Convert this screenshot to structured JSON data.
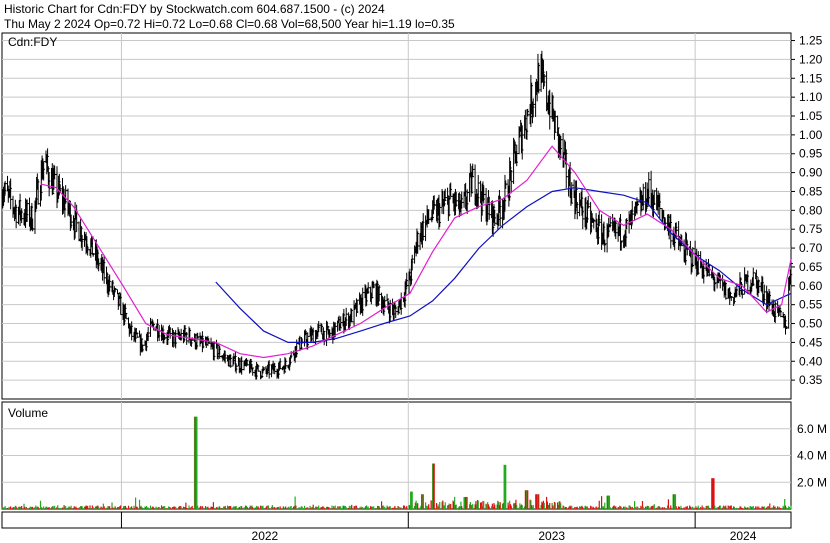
{
  "header": {
    "line1": "Historic Chart for Cdn:FDY by Stockwatch.com 604.687.1500 - (c) 2024",
    "line2": "Thu May  2 2024  Op=0.72  Hi=0.72  Lo=0.68  Cl=0.68  Vol=68,500  Year hi=1.19  lo=0.35"
  },
  "colors": {
    "price_bar": "#000000",
    "ma_short": "#e020d0",
    "ma_long": "#1010c0",
    "vol_up": "#22aa22",
    "vol_down": "#dd1111",
    "grid": "#c8c8c8"
  },
  "chart_data": [
    {
      "type": "line",
      "name": "price",
      "title": "Cdn:FDY",
      "yaxis_side": "right",
      "ylim": [
        0.3,
        1.27
      ],
      "yticks": [
        "0.35",
        "0.40",
        "0.45",
        "0.50",
        "0.55",
        "0.60",
        "0.65",
        "0.70",
        "0.75",
        "0.80",
        "0.85",
        "0.90",
        "0.95",
        "1.00",
        "1.05",
        "1.10",
        "1.15",
        "1.20",
        "1.25"
      ],
      "grid": true,
      "x_range": [
        "2021-08-02",
        "2024-05-02"
      ],
      "xticks": [
        "2022",
        "2023",
        "2024"
      ],
      "series": [
        {
          "kind": "ohlc_close",
          "points": [
            [
              "2021-08-02",
              0.86
            ],
            [
              "2021-08-20",
              0.8
            ],
            [
              "2021-09-10",
              0.78
            ],
            [
              "2021-09-24",
              0.93
            ],
            [
              "2021-10-08",
              0.86
            ],
            [
              "2021-10-22",
              0.82
            ],
            [
              "2021-11-05",
              0.76
            ],
            [
              "2021-11-19",
              0.72
            ],
            [
              "2021-12-03",
              0.66
            ],
            [
              "2021-12-17",
              0.6
            ],
            [
              "2022-01-03",
              0.53
            ],
            [
              "2022-01-14",
              0.47
            ],
            [
              "2022-01-28",
              0.44
            ],
            [
              "2022-02-11",
              0.5
            ],
            [
              "2022-02-25",
              0.47
            ],
            [
              "2022-03-11",
              0.46
            ],
            [
              "2022-03-25",
              0.47
            ],
            [
              "2022-04-08",
              0.45
            ],
            [
              "2022-04-22",
              0.44
            ],
            [
              "2022-05-06",
              0.42
            ],
            [
              "2022-05-20",
              0.4
            ],
            [
              "2022-06-03",
              0.39
            ],
            [
              "2022-06-17",
              0.38
            ],
            [
              "2022-07-01",
              0.37
            ],
            [
              "2022-07-15",
              0.38
            ],
            [
              "2022-07-29",
              0.39
            ],
            [
              "2022-08-12",
              0.44
            ],
            [
              "2022-08-26",
              0.46
            ],
            [
              "2022-09-09",
              0.48
            ],
            [
              "2022-09-23",
              0.47
            ],
            [
              "2022-10-07",
              0.5
            ],
            [
              "2022-10-21",
              0.52
            ],
            [
              "2022-11-04",
              0.56
            ],
            [
              "2022-11-18",
              0.59
            ],
            [
              "2022-12-02",
              0.55
            ],
            [
              "2022-12-16",
              0.53
            ],
            [
              "2023-01-03",
              0.62
            ],
            [
              "2023-01-13",
              0.73
            ],
            [
              "2023-01-27",
              0.78
            ],
            [
              "2023-02-10",
              0.8
            ],
            [
              "2023-02-24",
              0.83
            ],
            [
              "2023-03-10",
              0.8
            ],
            [
              "2023-03-24",
              0.88
            ],
            [
              "2023-04-07",
              0.82
            ],
            [
              "2023-04-21",
              0.78
            ],
            [
              "2023-05-05",
              0.84
            ],
            [
              "2023-05-19",
              0.96
            ],
            [
              "2023-06-02",
              1.06
            ],
            [
              "2023-06-16",
              1.16
            ],
            [
              "2023-06-30",
              1.08
            ],
            [
              "2023-07-14",
              0.96
            ],
            [
              "2023-07-28",
              0.85
            ],
            [
              "2023-08-11",
              0.8
            ],
            [
              "2023-08-25",
              0.76
            ],
            [
              "2023-09-08",
              0.73
            ],
            [
              "2023-09-22",
              0.74
            ],
            [
              "2023-10-06",
              0.75
            ],
            [
              "2023-10-20",
              0.8
            ],
            [
              "2023-11-03",
              0.85
            ],
            [
              "2023-11-17",
              0.8
            ],
            [
              "2023-12-01",
              0.75
            ],
            [
              "2023-12-15",
              0.7
            ],
            [
              "2024-01-05",
              0.66
            ],
            [
              "2024-01-19",
              0.63
            ],
            [
              "2024-02-02",
              0.6
            ],
            [
              "2024-02-16",
              0.57
            ],
            [
              "2024-03-01",
              0.6
            ],
            [
              "2024-03-15",
              0.62
            ],
            [
              "2024-03-29",
              0.58
            ],
            [
              "2024-04-12",
              0.53
            ],
            [
              "2024-04-26",
              0.5
            ],
            [
              "2024-05-02",
              0.68
            ]
          ]
        },
        {
          "kind": "moving_average_short",
          "points": [
            [
              "2021-09-20",
              0.87
            ],
            [
              "2021-10-10",
              0.86
            ],
            [
              "2021-11-01",
              0.81
            ],
            [
              "2021-12-01",
              0.71
            ],
            [
              "2022-01-03",
              0.6
            ],
            [
              "2022-02-01",
              0.5
            ],
            [
              "2022-03-01",
              0.47
            ],
            [
              "2022-04-01",
              0.46
            ],
            [
              "2022-05-01",
              0.45
            ],
            [
              "2022-06-01",
              0.42
            ],
            [
              "2022-07-01",
              0.41
            ],
            [
              "2022-08-01",
              0.42
            ],
            [
              "2022-09-01",
              0.44
            ],
            [
              "2022-10-01",
              0.47
            ],
            [
              "2022-11-01",
              0.5
            ],
            [
              "2022-12-01",
              0.54
            ],
            [
              "2023-01-03",
              0.58
            ],
            [
              "2023-02-01",
              0.69
            ],
            [
              "2023-03-01",
              0.78
            ],
            [
              "2023-04-01",
              0.81
            ],
            [
              "2023-05-01",
              0.83
            ],
            [
              "2023-06-01",
              0.88
            ],
            [
              "2023-07-03",
              0.97
            ],
            [
              "2023-08-01",
              0.9
            ],
            [
              "2023-09-01",
              0.8
            ],
            [
              "2023-10-02",
              0.76
            ],
            [
              "2023-11-01",
              0.79
            ],
            [
              "2023-12-01",
              0.75
            ],
            [
              "2024-01-02",
              0.68
            ],
            [
              "2024-02-01",
              0.62
            ],
            [
              "2024-03-01",
              0.6
            ],
            [
              "2024-04-01",
              0.53
            ],
            [
              "2024-04-20",
              0.55
            ],
            [
              "2024-05-02",
              0.67
            ]
          ]
        },
        {
          "kind": "moving_average_long",
          "points": [
            [
              "2022-05-01",
              0.61
            ],
            [
              "2022-06-01",
              0.54
            ],
            [
              "2022-07-01",
              0.48
            ],
            [
              "2022-08-01",
              0.45
            ],
            [
              "2022-09-01",
              0.45
            ],
            [
              "2022-10-01",
              0.46
            ],
            [
              "2022-11-01",
              0.48
            ],
            [
              "2022-12-01",
              0.5
            ],
            [
              "2023-01-03",
              0.52
            ],
            [
              "2023-02-01",
              0.56
            ],
            [
              "2023-03-01",
              0.62
            ],
            [
              "2023-04-01",
              0.7
            ],
            [
              "2023-05-01",
              0.76
            ],
            [
              "2023-06-01",
              0.81
            ],
            [
              "2023-07-03",
              0.85
            ],
            [
              "2023-08-01",
              0.86
            ],
            [
              "2023-09-01",
              0.85
            ],
            [
              "2023-10-02",
              0.84
            ],
            [
              "2023-11-01",
              0.82
            ],
            [
              "2023-12-01",
              0.74
            ],
            [
              "2024-01-02",
              0.68
            ],
            [
              "2024-02-01",
              0.64
            ],
            [
              "2024-03-01",
              0.59
            ],
            [
              "2024-04-01",
              0.55
            ],
            [
              "2024-05-02",
              0.58
            ]
          ]
        }
      ]
    },
    {
      "type": "bar",
      "title": "Volume",
      "yaxis_side": "right",
      "ylim": [
        0,
        8
      ],
      "yticks": [
        "2.0 M",
        "4.0 M",
        "6.0 M"
      ],
      "grid": true,
      "spikes": [
        [
          "2022-04-05",
          6.9
        ],
        [
          "2023-01-06",
          1.3
        ],
        [
          "2023-01-20",
          1.1
        ],
        [
          "2023-02-03",
          3.4
        ],
        [
          "2023-03-15",
          0.9
        ],
        [
          "2023-05-05",
          3.3
        ],
        [
          "2023-06-01",
          1.4
        ],
        [
          "2023-06-14",
          1.1
        ],
        [
          "2023-12-05",
          1.1
        ],
        [
          "2024-01-23",
          2.3
        ],
        [
          "2023-09-12",
          1.0
        ]
      ]
    }
  ]
}
